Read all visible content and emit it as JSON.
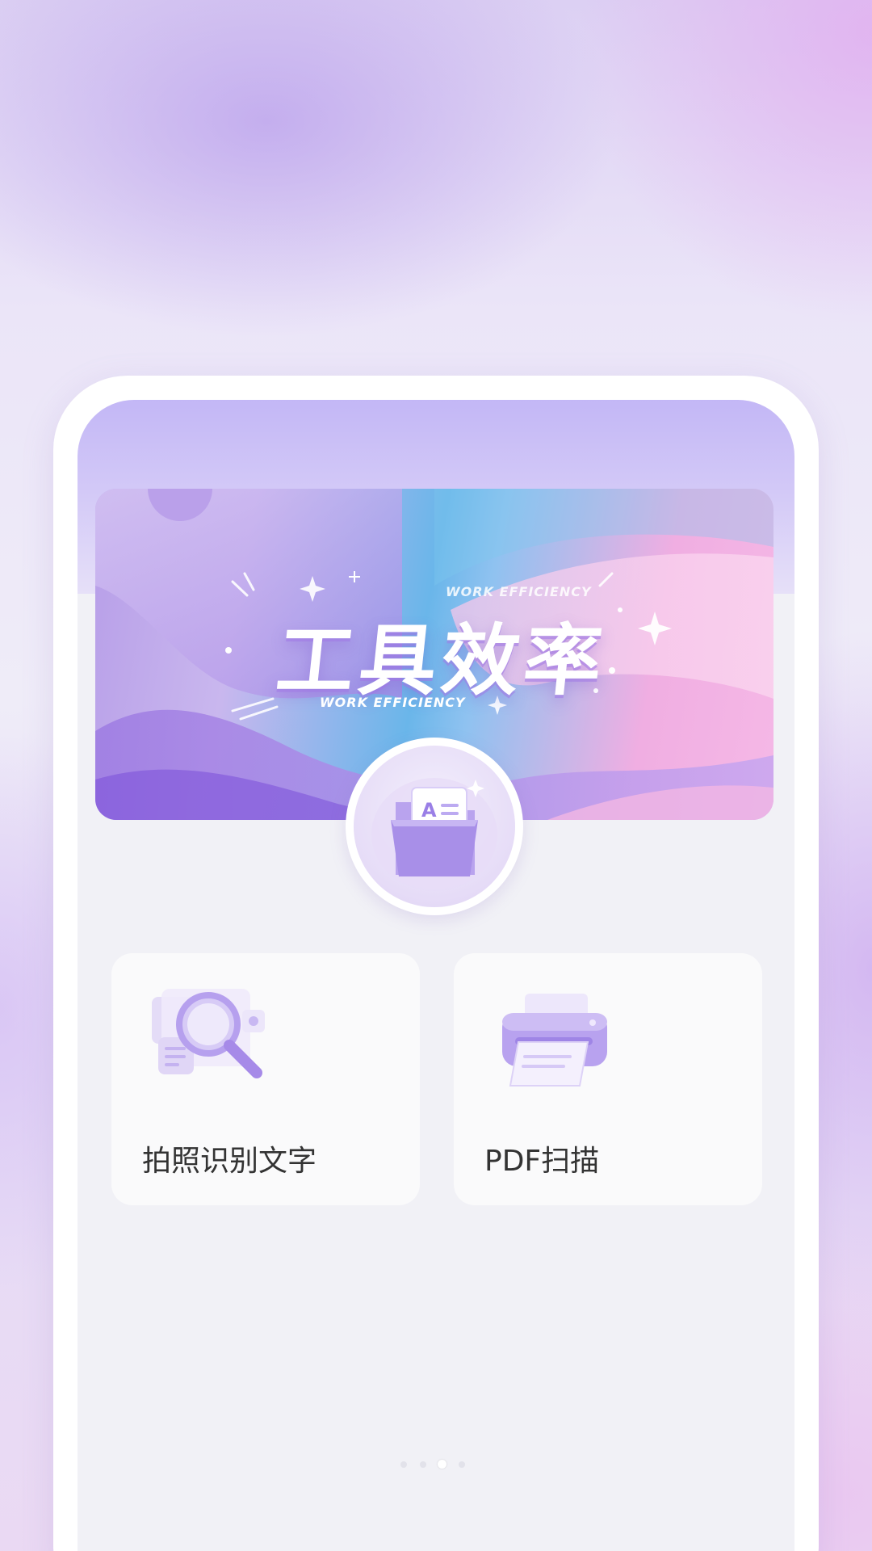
{
  "banner": {
    "title": "工具效率",
    "subtitle_top": "WORK EFFICIENCY",
    "subtitle_bottom": "WORK EFFICIENCY"
  },
  "center_icon": {
    "icon": "folder-document-icon",
    "glyph": "A"
  },
  "features": [
    {
      "label": "拍照识别文字",
      "icon": "magnifier-document-icon"
    },
    {
      "label": "PDF扫描",
      "icon": "printer-icon"
    }
  ],
  "pager": {
    "count": 4,
    "active_index": 2
  },
  "colors": {
    "accent": "#a78bea",
    "card_bg": "#fafafb",
    "screen_bg": "#f1f1f6",
    "label_text": "#333333"
  }
}
